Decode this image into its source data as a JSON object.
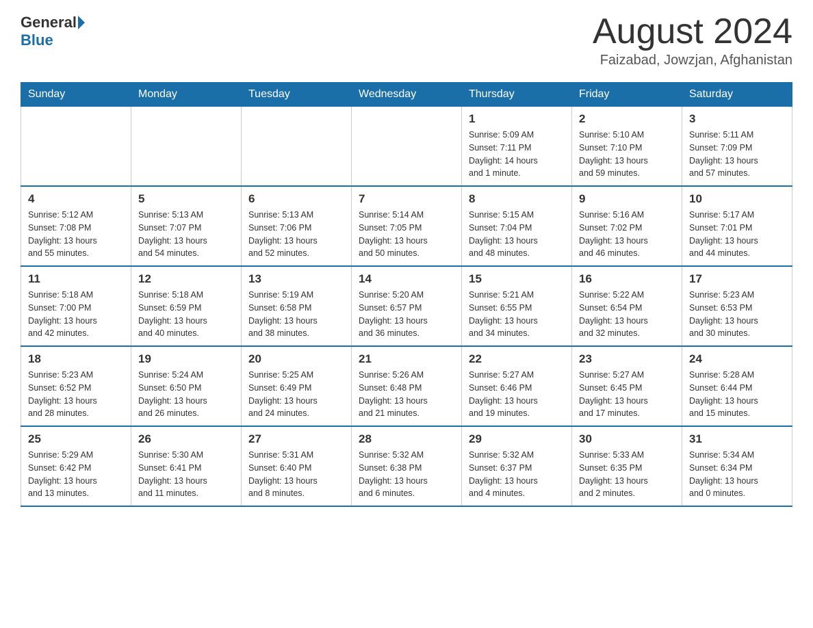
{
  "header": {
    "logo_general": "General",
    "logo_blue": "Blue",
    "title": "August 2024",
    "location": "Faizabad, Jowzjan, Afghanistan"
  },
  "weekdays": [
    "Sunday",
    "Monday",
    "Tuesday",
    "Wednesday",
    "Thursday",
    "Friday",
    "Saturday"
  ],
  "weeks": [
    [
      {
        "day": "",
        "info": ""
      },
      {
        "day": "",
        "info": ""
      },
      {
        "day": "",
        "info": ""
      },
      {
        "day": "",
        "info": ""
      },
      {
        "day": "1",
        "info": "Sunrise: 5:09 AM\nSunset: 7:11 PM\nDaylight: 14 hours\nand 1 minute."
      },
      {
        "day": "2",
        "info": "Sunrise: 5:10 AM\nSunset: 7:10 PM\nDaylight: 13 hours\nand 59 minutes."
      },
      {
        "day": "3",
        "info": "Sunrise: 5:11 AM\nSunset: 7:09 PM\nDaylight: 13 hours\nand 57 minutes."
      }
    ],
    [
      {
        "day": "4",
        "info": "Sunrise: 5:12 AM\nSunset: 7:08 PM\nDaylight: 13 hours\nand 55 minutes."
      },
      {
        "day": "5",
        "info": "Sunrise: 5:13 AM\nSunset: 7:07 PM\nDaylight: 13 hours\nand 54 minutes."
      },
      {
        "day": "6",
        "info": "Sunrise: 5:13 AM\nSunset: 7:06 PM\nDaylight: 13 hours\nand 52 minutes."
      },
      {
        "day": "7",
        "info": "Sunrise: 5:14 AM\nSunset: 7:05 PM\nDaylight: 13 hours\nand 50 minutes."
      },
      {
        "day": "8",
        "info": "Sunrise: 5:15 AM\nSunset: 7:04 PM\nDaylight: 13 hours\nand 48 minutes."
      },
      {
        "day": "9",
        "info": "Sunrise: 5:16 AM\nSunset: 7:02 PM\nDaylight: 13 hours\nand 46 minutes."
      },
      {
        "day": "10",
        "info": "Sunrise: 5:17 AM\nSunset: 7:01 PM\nDaylight: 13 hours\nand 44 minutes."
      }
    ],
    [
      {
        "day": "11",
        "info": "Sunrise: 5:18 AM\nSunset: 7:00 PM\nDaylight: 13 hours\nand 42 minutes."
      },
      {
        "day": "12",
        "info": "Sunrise: 5:18 AM\nSunset: 6:59 PM\nDaylight: 13 hours\nand 40 minutes."
      },
      {
        "day": "13",
        "info": "Sunrise: 5:19 AM\nSunset: 6:58 PM\nDaylight: 13 hours\nand 38 minutes."
      },
      {
        "day": "14",
        "info": "Sunrise: 5:20 AM\nSunset: 6:57 PM\nDaylight: 13 hours\nand 36 minutes."
      },
      {
        "day": "15",
        "info": "Sunrise: 5:21 AM\nSunset: 6:55 PM\nDaylight: 13 hours\nand 34 minutes."
      },
      {
        "day": "16",
        "info": "Sunrise: 5:22 AM\nSunset: 6:54 PM\nDaylight: 13 hours\nand 32 minutes."
      },
      {
        "day": "17",
        "info": "Sunrise: 5:23 AM\nSunset: 6:53 PM\nDaylight: 13 hours\nand 30 minutes."
      }
    ],
    [
      {
        "day": "18",
        "info": "Sunrise: 5:23 AM\nSunset: 6:52 PM\nDaylight: 13 hours\nand 28 minutes."
      },
      {
        "day": "19",
        "info": "Sunrise: 5:24 AM\nSunset: 6:50 PM\nDaylight: 13 hours\nand 26 minutes."
      },
      {
        "day": "20",
        "info": "Sunrise: 5:25 AM\nSunset: 6:49 PM\nDaylight: 13 hours\nand 24 minutes."
      },
      {
        "day": "21",
        "info": "Sunrise: 5:26 AM\nSunset: 6:48 PM\nDaylight: 13 hours\nand 21 minutes."
      },
      {
        "day": "22",
        "info": "Sunrise: 5:27 AM\nSunset: 6:46 PM\nDaylight: 13 hours\nand 19 minutes."
      },
      {
        "day": "23",
        "info": "Sunrise: 5:27 AM\nSunset: 6:45 PM\nDaylight: 13 hours\nand 17 minutes."
      },
      {
        "day": "24",
        "info": "Sunrise: 5:28 AM\nSunset: 6:44 PM\nDaylight: 13 hours\nand 15 minutes."
      }
    ],
    [
      {
        "day": "25",
        "info": "Sunrise: 5:29 AM\nSunset: 6:42 PM\nDaylight: 13 hours\nand 13 minutes."
      },
      {
        "day": "26",
        "info": "Sunrise: 5:30 AM\nSunset: 6:41 PM\nDaylight: 13 hours\nand 11 minutes."
      },
      {
        "day": "27",
        "info": "Sunrise: 5:31 AM\nSunset: 6:40 PM\nDaylight: 13 hours\nand 8 minutes."
      },
      {
        "day": "28",
        "info": "Sunrise: 5:32 AM\nSunset: 6:38 PM\nDaylight: 13 hours\nand 6 minutes."
      },
      {
        "day": "29",
        "info": "Sunrise: 5:32 AM\nSunset: 6:37 PM\nDaylight: 13 hours\nand 4 minutes."
      },
      {
        "day": "30",
        "info": "Sunrise: 5:33 AM\nSunset: 6:35 PM\nDaylight: 13 hours\nand 2 minutes."
      },
      {
        "day": "31",
        "info": "Sunrise: 5:34 AM\nSunset: 6:34 PM\nDaylight: 13 hours\nand 0 minutes."
      }
    ]
  ]
}
